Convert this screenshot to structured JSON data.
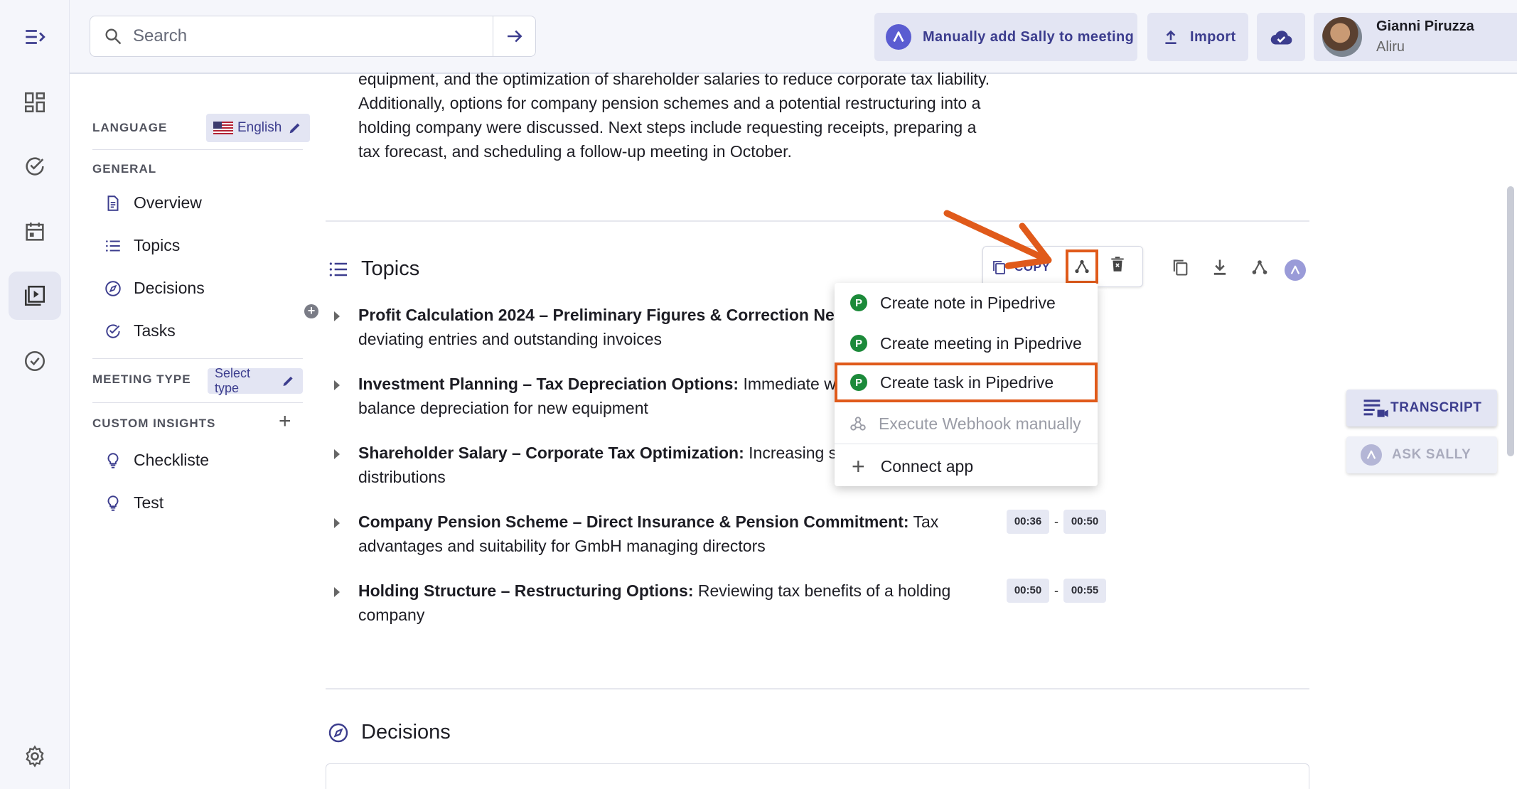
{
  "topbar": {
    "search_placeholder": "Search",
    "sally_button": "Manually add Sally to meeting",
    "import_button": "Import",
    "user": {
      "name": "Gianni Piruzza",
      "org": "Aliru"
    }
  },
  "settings": {
    "language_label": "LANGUAGE",
    "language_value": "English",
    "general_label": "GENERAL",
    "general_items": [
      "Overview",
      "Topics",
      "Decisions",
      "Tasks"
    ],
    "meeting_type_label": "MEETING TYPE",
    "meeting_type_value": "Select type",
    "custom_insights_label": "CUSTOM INSIGHTS",
    "custom_insights_items": [
      "Checkliste",
      "Test"
    ]
  },
  "summary_text": "equipment, and the optimization of shareholder salaries to reduce corporate tax liability. Additionally, options for company pension schemes and a potential restructuring into a holding company were discussed. Next steps include requesting receipts, preparing a tax forecast, and scheduling a follow-up meeting in October.",
  "topics": {
    "title": "Topics",
    "copy_label": "COPY",
    "items": [
      {
        "title": "Profit Calculation 2024 – Preliminary Figures & Correction Need",
        "desc": "deviating entries and outstanding invoices",
        "start": "",
        "end": ""
      },
      {
        "title": "Investment Planning – Tax Depreciation Options:",
        "desc": " Immediate writ",
        "desc2": "balance depreciation for new equipment",
        "start": "",
        "end": ""
      },
      {
        "title": "Shareholder Salary – Corporate Tax Optimization:",
        "desc": " Increasing sala",
        "desc2": "distributions",
        "start": "",
        "end": ""
      },
      {
        "title": "Company Pension Scheme – Direct Insurance & Pension Commitment:",
        "desc": " Tax advantages and suitability for GmbH managing directors",
        "start": "00:36",
        "end": "00:50"
      },
      {
        "title": "Holding Structure – Restructuring Options:",
        "desc": " Reviewing tax benefits of a holding company",
        "start": "00:50",
        "end": "00:55"
      }
    ]
  },
  "menu": {
    "items": [
      {
        "label": "Create note in Pipedrive",
        "icon": "pipedrive-icon"
      },
      {
        "label": "Create meeting in Pipedrive",
        "icon": "pipedrive-icon"
      },
      {
        "label": "Create task in Pipedrive",
        "icon": "pipedrive-icon"
      },
      {
        "label": "Execute Webhook manually",
        "icon": "webhook-icon"
      },
      {
        "label": "Connect app",
        "icon": "plus-icon"
      }
    ],
    "pipedrive_glyph": "P"
  },
  "decisions": {
    "title": "Decisions"
  },
  "floating": {
    "transcript": "TRANSCRIPT",
    "ask_sally": "ASK SALLY"
  },
  "colors": {
    "accent": "#3c3d8e",
    "highlight": "#e05a1a",
    "pipedrive": "#1c8a3a"
  }
}
